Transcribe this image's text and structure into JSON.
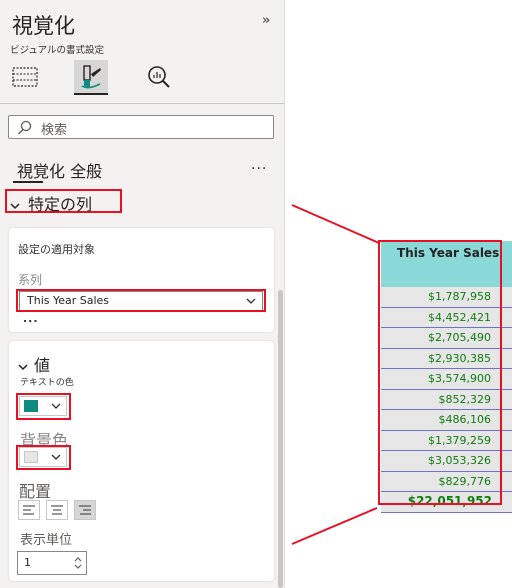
{
  "panel": {
    "title": "視覚化",
    "subtitle": "ビジュアルの書式設定",
    "collapse_glyph": "»",
    "search": {
      "placeholder": "検索"
    },
    "tabs": [
      "視覚化",
      "全般"
    ],
    "more": "...",
    "section": {
      "chevron": "⌄",
      "title": "特定の列"
    },
    "apply_card": {
      "heading": "設定の適用対象",
      "series_label": "系列",
      "series_value": "This Year Sales",
      "more": "..."
    },
    "values_card": {
      "chevron": "⌄",
      "heading": "値",
      "text_color_label": "テキストの色",
      "text_color": "#0f8a80",
      "bg_color_label": "背景色",
      "bg_color": "#e6e6e6",
      "alignment_label": "配置",
      "display_units_label": "表示単位",
      "display_units_value": "1"
    }
  },
  "table": {
    "header": "This Year Sales",
    "rows": [
      "$1,787,958",
      "$4,452,421",
      "$2,705,490",
      "$2,930,385",
      "$3,574,900",
      "$852,329",
      "$486,106",
      "$1,379,259",
      "$3,053,326",
      "$829,776"
    ],
    "total": "$22,051,952"
  },
  "colors": {
    "highlight": "#e81123",
    "header_bg": "#8ad8d8",
    "value_text": "#107c10",
    "row_bg": "#e6e6e6"
  }
}
